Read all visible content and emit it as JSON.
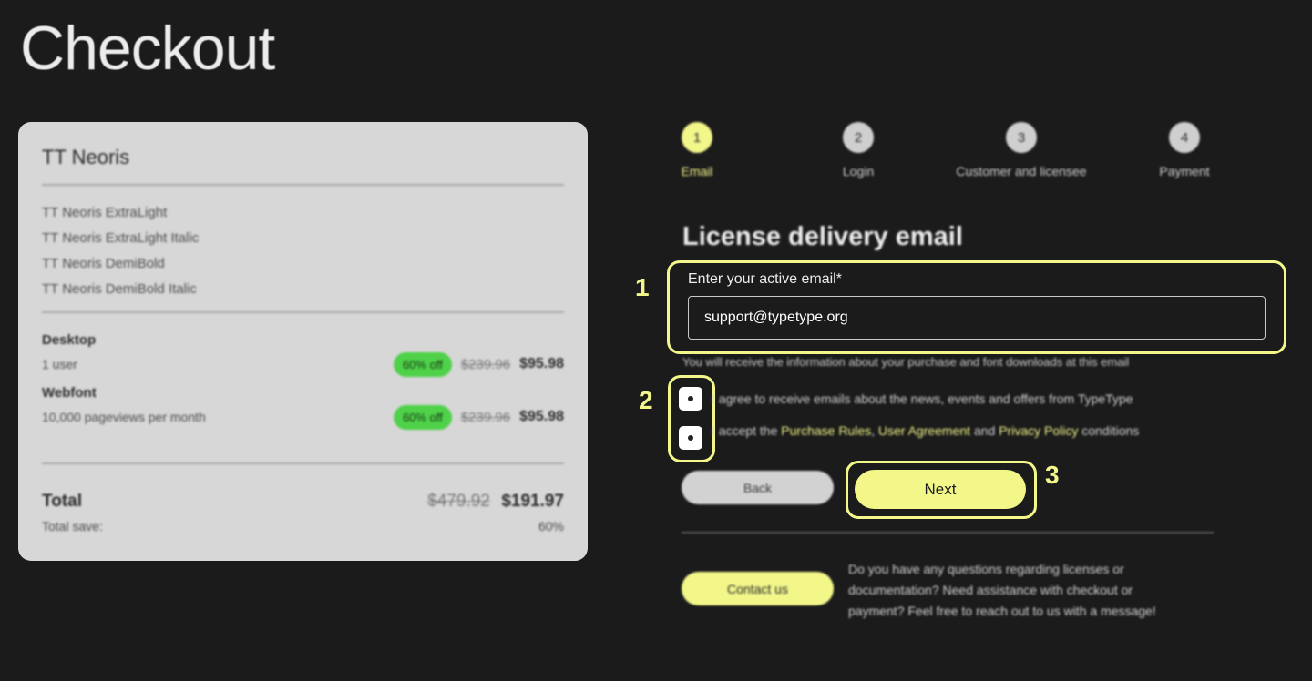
{
  "page": {
    "title": "Checkout"
  },
  "summary": {
    "product": "TT Neoris",
    "styles": [
      "TT Neoris ExtraLight",
      "TT Neoris ExtraLight Italic",
      "TT Neoris DemiBold",
      "TT Neoris DemiBold Italic"
    ],
    "licenses": [
      {
        "title": "Desktop",
        "desc": "1 user",
        "badge": "60% off",
        "old_price": "$239.96",
        "new_price": "$95.98"
      },
      {
        "title": "Webfont",
        "desc": "10,000 pageviews per month",
        "badge": "60% off",
        "old_price": "$239.96",
        "new_price": "$95.98"
      }
    ],
    "total_label": "Total",
    "total_old": "$479.92",
    "total_new": "$191.97",
    "save_label": "Total save:",
    "save_value": "60%"
  },
  "steps": [
    {
      "num": "1",
      "label": "Email",
      "active": true
    },
    {
      "num": "2",
      "label": "Login",
      "active": false
    },
    {
      "num": "3",
      "label": "Customer and licensee",
      "active": false
    },
    {
      "num": "4",
      "label": "Payment",
      "active": false
    }
  ],
  "form": {
    "section_title": "License delivery email",
    "email_label": "Enter your active email*",
    "email_value": "support@typetype.org",
    "notice": "You will receive the information about your purchase and font downloads at this email",
    "checkbox_news": "I agree to receive emails about the news, events and offers from TypeType",
    "checkbox_terms_prefix": "I accept the",
    "checkbox_terms_link1": "Purchase Rules",
    "checkbox_terms_link2": "User Agreement",
    "checkbox_terms_and": "and",
    "checkbox_terms_link3": "Privacy Policy",
    "checkbox_terms_suffix": "conditions",
    "back_label": "Back",
    "next_label": "Next",
    "contact_label": "Contact us",
    "contact_text": "Do you have any questions regarding licenses or documentation? Need assistance with checkout or payment? Feel free to reach out to us with a message!"
  },
  "annotations": {
    "marker_1": "1",
    "marker_2": "2",
    "marker_3": "3"
  },
  "colors": {
    "accent": "#f3f78a",
    "badge": "#4fd14a",
    "background": "#1b1b1b",
    "card": "#d7d7d7"
  }
}
